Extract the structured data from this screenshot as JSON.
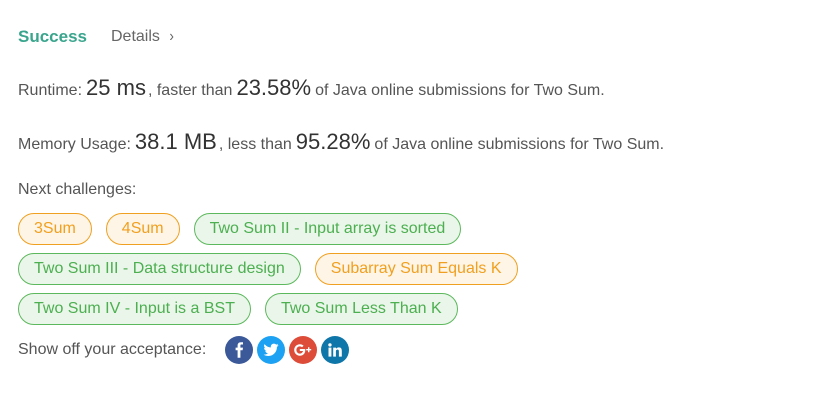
{
  "result": {
    "status": "Success",
    "details_label": "Details",
    "details_chevron": "›"
  },
  "runtime": {
    "label": "Runtime:",
    "value": "25 ms",
    "mid_text": ", faster than",
    "percent": "23.58%",
    "suffix": "of Java online submissions for Two Sum."
  },
  "memory": {
    "label": "Memory Usage:",
    "value": "38.1 MB",
    "mid_text": ", less than",
    "percent": "95.28%",
    "suffix": "of Java online submissions for Two Sum."
  },
  "next_challenges": {
    "label": "Next challenges:",
    "items": [
      {
        "label": "3Sum",
        "difficulty": "medium"
      },
      {
        "label": "4Sum",
        "difficulty": "medium"
      },
      {
        "label": "Two Sum II - Input array is sorted",
        "difficulty": "easy"
      },
      {
        "label": "Two Sum III - Data structure design",
        "difficulty": "easy"
      },
      {
        "label": "Subarray Sum Equals K",
        "difficulty": "medium"
      },
      {
        "label": "Two Sum IV - Input is a BST",
        "difficulty": "easy"
      },
      {
        "label": "Two Sum Less Than K",
        "difficulty": "easy"
      }
    ]
  },
  "share": {
    "label": "Show off your acceptance:",
    "buttons": [
      {
        "icon": "facebook-icon",
        "color": "#3b5998"
      },
      {
        "icon": "twitter-icon",
        "color": "#1da1f2"
      },
      {
        "icon": "google-plus-icon",
        "color": "#dd4b39"
      },
      {
        "icon": "linkedin-icon",
        "color": "#0e76a8"
      }
    ]
  },
  "colors": {
    "success": "#3aa58d",
    "medium_text": "#f0a020",
    "medium_bg": "#fff5e6",
    "easy_text": "#4caf50",
    "easy_bg": "#eaf6ea"
  }
}
